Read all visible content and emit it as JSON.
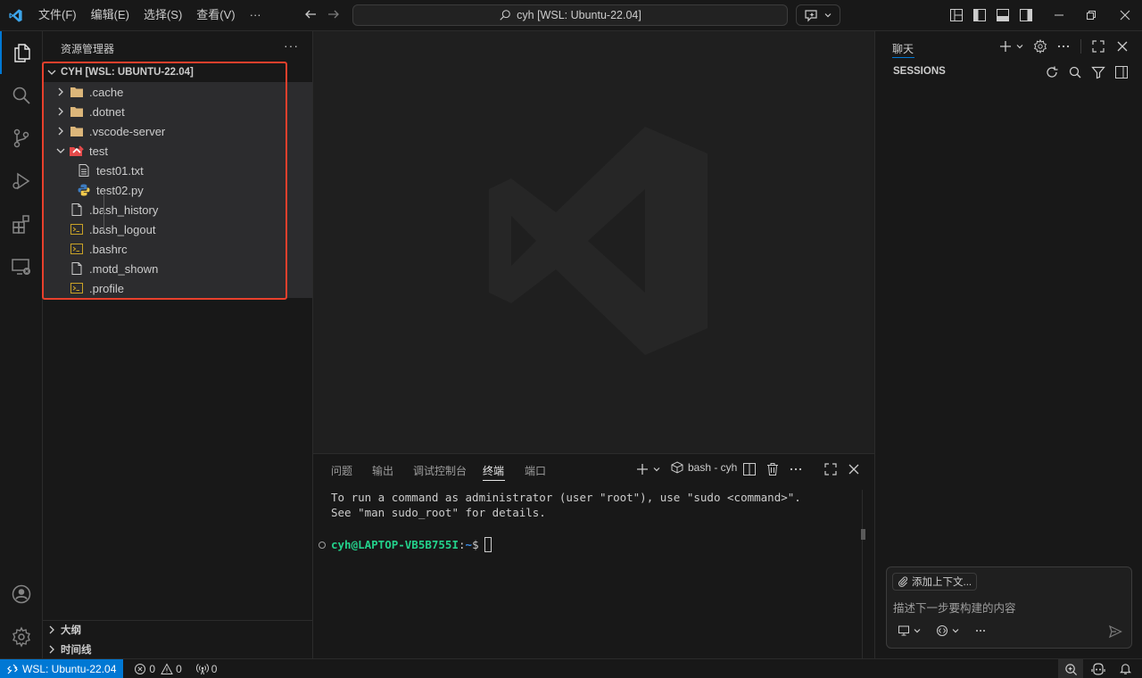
{
  "menu": [
    "文件(F)",
    "编辑(E)",
    "选择(S)",
    "查看(V)",
    "···"
  ],
  "command_center": {
    "text": "cyh [WSL: Ubuntu-22.04]"
  },
  "sidebar": {
    "title": "资源管理器",
    "more": "···",
    "workspace": "CYH [WSL: UBUNTU-22.04]",
    "tree": [
      {
        "name": ".cache",
        "kind": "folder"
      },
      {
        "name": ".dotnet",
        "kind": "folder"
      },
      {
        "name": ".vscode-server",
        "kind": "folder"
      },
      {
        "name": "test",
        "kind": "folder-open"
      },
      {
        "name": "test01.txt",
        "kind": "file-text"
      },
      {
        "name": "test02.py",
        "kind": "file-python"
      },
      {
        "name": ".bash_history",
        "kind": "file"
      },
      {
        "name": ".bash_logout",
        "kind": "file-shell"
      },
      {
        "name": ".bashrc",
        "kind": "file-shell"
      },
      {
        "name": ".motd_shown",
        "kind": "file"
      },
      {
        "name": ".profile",
        "kind": "file-shell"
      }
    ],
    "outline": "大纲",
    "timeline": "时间线"
  },
  "panel": {
    "tabs": [
      "问题",
      "输出",
      "调试控制台",
      "终端",
      "端口"
    ],
    "active_tab": "终端",
    "terminal_name": "bash - cyh",
    "lines": [
      "To run a command as administrator (user \"root\"), use \"sudo <command>\".",
      "See \"man sudo_root\" for details."
    ],
    "prompt": {
      "user": "cyh@LAPTOP-VB5B755I",
      "sep": ":",
      "path": "~",
      "dollar": "$"
    }
  },
  "chat": {
    "title": "聊天",
    "sessions": "SESSIONS",
    "add_context": "添加上下文...",
    "placeholder": "描述下一步要构建的内容"
  },
  "status": {
    "remote": "WSL: Ubuntu-22.04",
    "errors": "0",
    "warnings": "0",
    "ports": "0"
  },
  "colors": {
    "accent": "#0078d4",
    "highlight_box": "#e8402c",
    "folder": "#dcb67a",
    "prompt_user": "#23d18b",
    "prompt_path": "#3b8eea"
  }
}
